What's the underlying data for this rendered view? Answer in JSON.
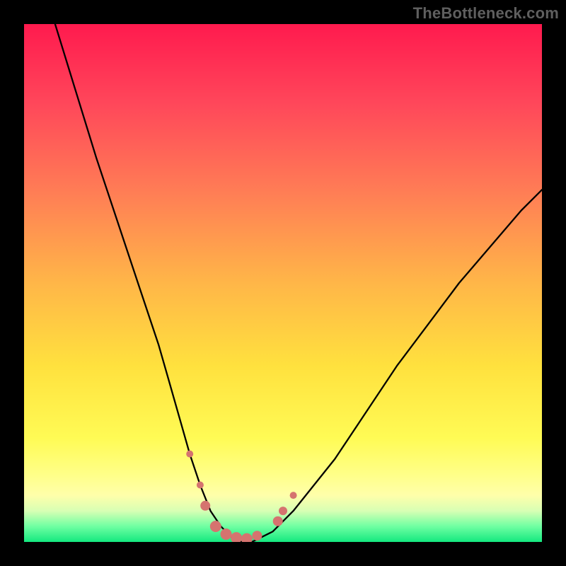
{
  "watermark": {
    "text": "TheBottleneck.com"
  },
  "chart_data": {
    "type": "line",
    "title": "",
    "xlabel": "",
    "ylabel": "",
    "xlim": [
      0,
      100
    ],
    "ylim": [
      0,
      100
    ],
    "series": [
      {
        "name": "bottleneck-curve",
        "x": [
          6,
          10,
          14,
          18,
          22,
          26,
          28,
          30,
          32,
          34,
          36,
          38,
          40,
          42,
          44,
          48,
          52,
          56,
          60,
          66,
          72,
          78,
          84,
          90,
          96,
          100
        ],
        "y": [
          100,
          87,
          74,
          62,
          50,
          38,
          31,
          24,
          17,
          11,
          6,
          3,
          1,
          0,
          0,
          2,
          6,
          11,
          16,
          25,
          34,
          42,
          50,
          57,
          64,
          68
        ]
      }
    ],
    "markers": {
      "name": "highlighted-points",
      "points": [
        {
          "x": 32,
          "y": 17,
          "r": 5
        },
        {
          "x": 34,
          "y": 11,
          "r": 5
        },
        {
          "x": 35,
          "y": 7,
          "r": 7
        },
        {
          "x": 37,
          "y": 3,
          "r": 8
        },
        {
          "x": 39,
          "y": 1.5,
          "r": 8
        },
        {
          "x": 41,
          "y": 0.8,
          "r": 8
        },
        {
          "x": 43,
          "y": 0.6,
          "r": 8
        },
        {
          "x": 45,
          "y": 1.2,
          "r": 7
        },
        {
          "x": 49,
          "y": 4,
          "r": 7
        },
        {
          "x": 50,
          "y": 6,
          "r": 6
        },
        {
          "x": 52,
          "y": 9,
          "r": 5
        }
      ],
      "color": "#d5736f"
    }
  }
}
